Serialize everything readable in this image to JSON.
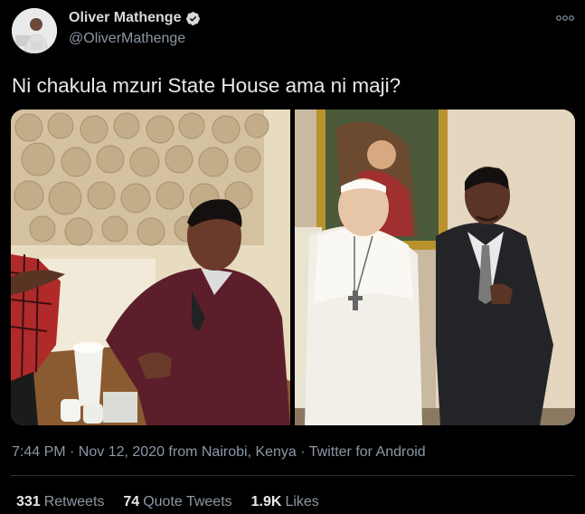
{
  "author": {
    "name": "Oliver Mathenge",
    "handle": "@OliverMathenge",
    "verified_icon": "verified-badge-icon",
    "avatar_icon": "profile-photo"
  },
  "tweet": {
    "text": "Ni chakula mzuri State House ama ni maji?",
    "media_icon": "photo-collage",
    "meta": "7:44 PM · Nov 12, 2020 from Nairobi, Kenya · Twitter for Android"
  },
  "stats": {
    "retweets_count": "331",
    "retweets_label": "Retweets",
    "quotes_count": "74",
    "quotes_label": "Quote Tweets",
    "likes_count": "1.9K",
    "likes_label": "Likes"
  },
  "colors": {
    "background": "#000000",
    "text_primary": "#e7e9ea",
    "text_secondary": "#8b98a5",
    "divider": "#2f3336",
    "verified": "#d9d9d9"
  }
}
